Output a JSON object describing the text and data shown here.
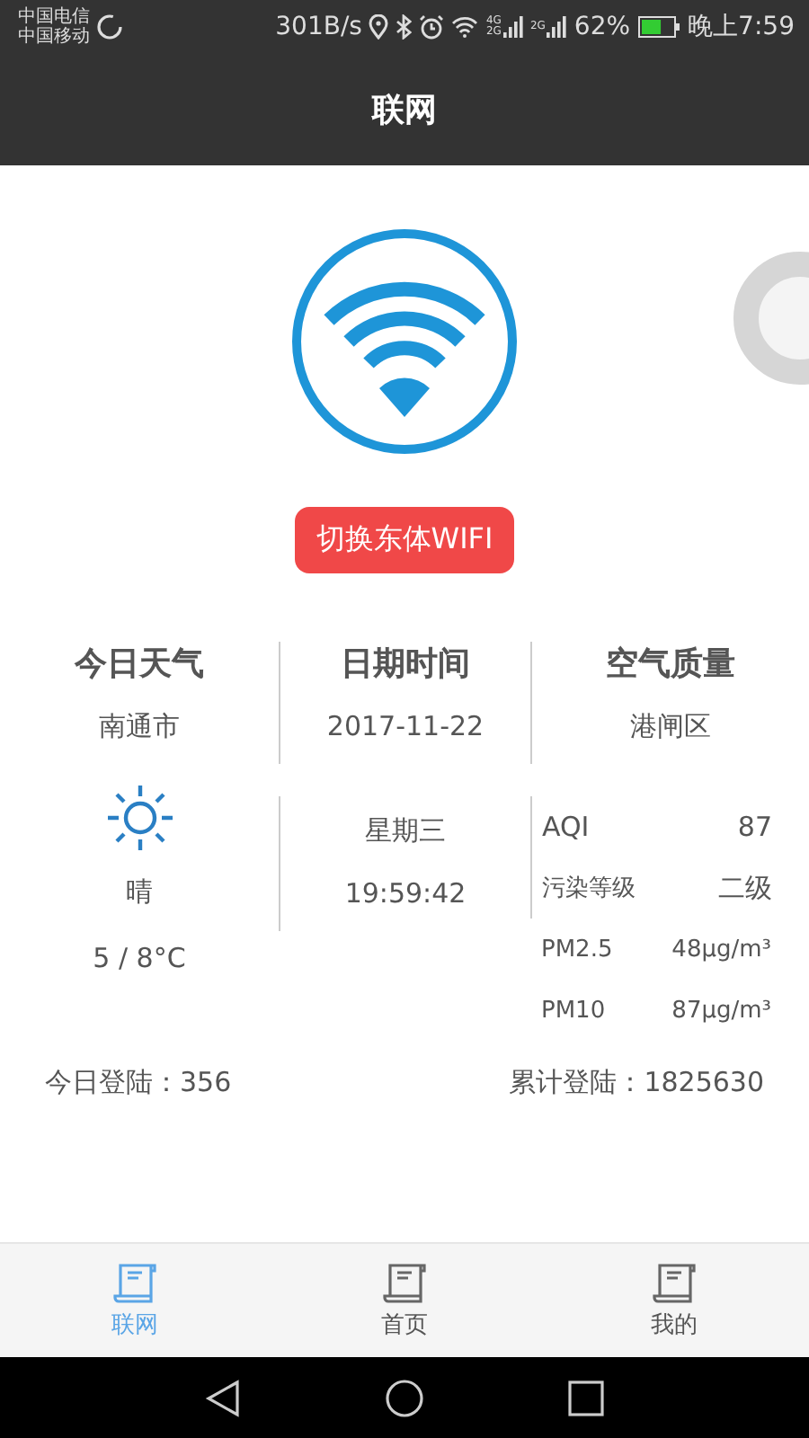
{
  "status_bar": {
    "carriers": [
      "中国电信",
      "中国移动"
    ],
    "speed": "301B/s",
    "signals": [
      {
        "labels": [
          "4G",
          "2G"
        ]
      },
      {
        "labels": [
          "2G"
        ]
      }
    ],
    "battery": {
      "percent": "62%",
      "level": 0.62
    },
    "time": "晚上7:59"
  },
  "title": "联网",
  "switch_button": "切换东体WIFI",
  "columns": [
    {
      "heading": "今日天气",
      "subheading": "南通市"
    },
    {
      "heading": "日期时间",
      "subheading": "2017-11-22"
    },
    {
      "heading": "空气质量",
      "subheading": "港闸区"
    }
  ],
  "weather": {
    "condition": "晴",
    "temperature": "5 / 8°C"
  },
  "datetime": {
    "weekday": "星期三",
    "time": "19:59:42"
  },
  "air": [
    {
      "label": "AQI",
      "value": "87"
    },
    {
      "label": "污染等级",
      "value": "二级"
    },
    {
      "label": "PM2.5",
      "value": "48μg/m³"
    },
    {
      "label": "PM10",
      "value": "87μg/m³"
    }
  ],
  "logins": {
    "today": "今日登陆：356",
    "total": "累计登陆：1825630"
  },
  "tabs": [
    {
      "label": "联网",
      "selected": true
    },
    {
      "label": "首页",
      "selected": false
    },
    {
      "label": "我的",
      "selected": false
    }
  ]
}
